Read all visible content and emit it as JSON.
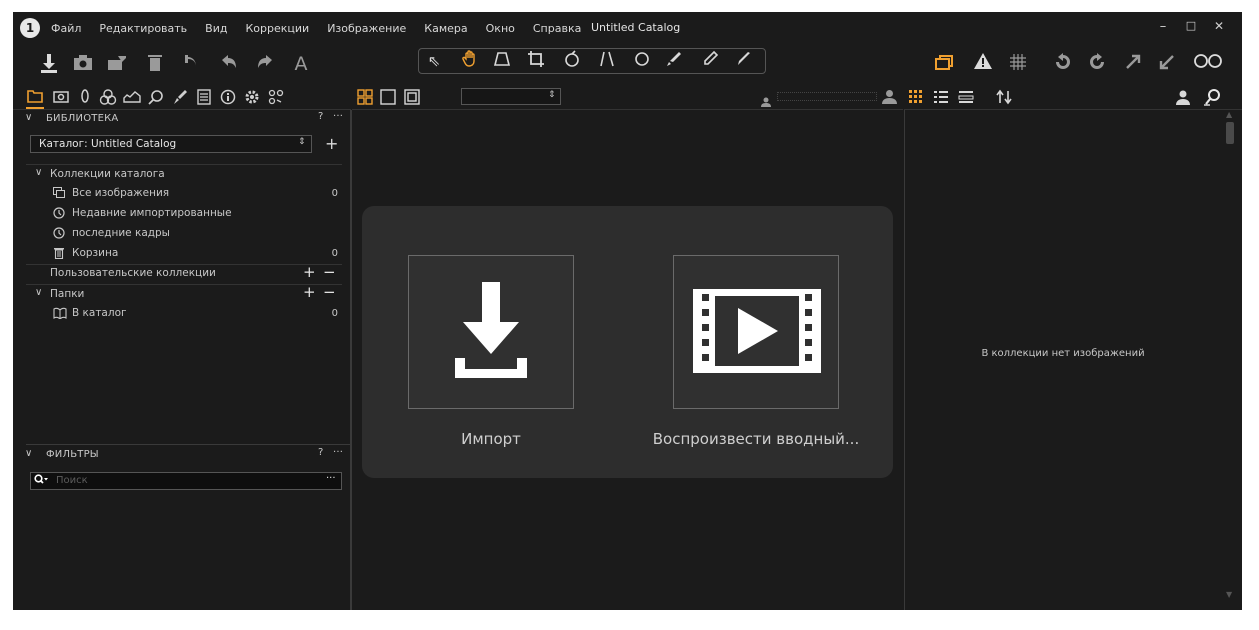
{
  "app": {
    "logo_glyph": "1"
  },
  "menu": [
    "Файл",
    "Редактировать",
    "Вид",
    "Коррекции",
    "Изображение",
    "Камера",
    "Окно",
    "Справка"
  ],
  "title": "Untitled Catalog",
  "window_controls": {
    "minimize": "–",
    "maximize": "□",
    "close": "✕"
  },
  "colors": {
    "accent": "#f0a030",
    "background": "#1b1b1b",
    "panel": "#2d2d2d"
  },
  "left_panel": {
    "library_title": "БИБЛИОТЕКА",
    "help": "?",
    "more": "···",
    "catalog_select": "Каталог: Untitled Catalog",
    "add": "+",
    "catalog_collections": "Коллекции каталога",
    "items": [
      {
        "label": "Все изображения",
        "count": "0",
        "icon": "stack-icon"
      },
      {
        "label": "Недавние импортированные",
        "count": "",
        "icon": "clock-icon"
      },
      {
        "label": "последние кадры",
        "count": "",
        "icon": "clock-icon"
      },
      {
        "label": "Корзина",
        "count": "0",
        "icon": "trash-icon"
      }
    ],
    "user_collections": "Пользовательские коллекции",
    "folders": "Папки",
    "to_catalog": {
      "label": "В каталог",
      "count": "0"
    },
    "filters_title": "ФИЛЬТРЫ",
    "search_placeholder": "Поиск",
    "search_more": "···"
  },
  "center": {
    "import_label": "Импорт",
    "intro_label": "Воспроизвести вводный..."
  },
  "right_panel": {
    "empty_message": "В коллекции нет изображений"
  }
}
